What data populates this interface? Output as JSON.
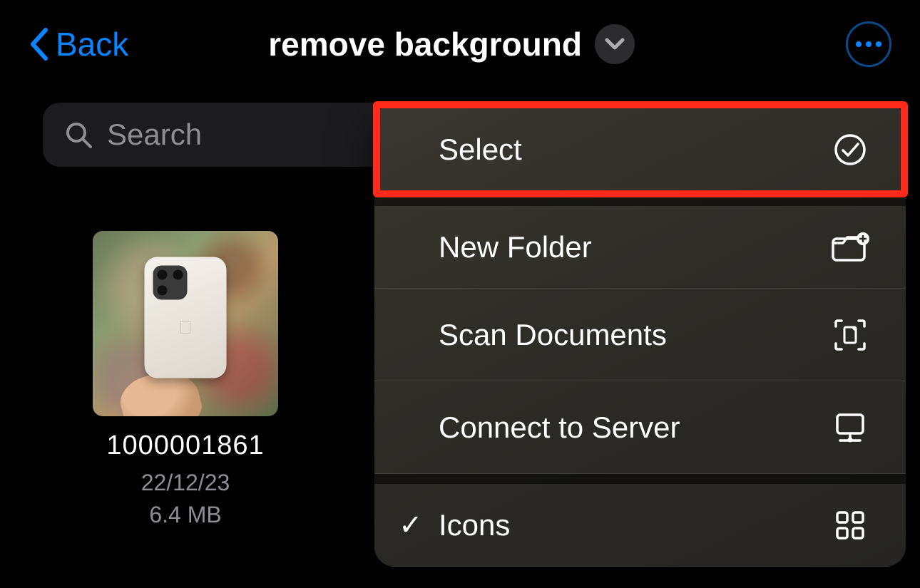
{
  "header": {
    "back_label": "Back",
    "title": "remove background"
  },
  "search": {
    "placeholder": "Search"
  },
  "file": {
    "name": "1000001861",
    "date": "22/12/23",
    "size": "6.4 MB"
  },
  "menu": {
    "select": "Select",
    "new_folder": "New Folder",
    "scan_documents": "Scan Documents",
    "connect_server": "Connect to Server",
    "icons": "Icons"
  }
}
